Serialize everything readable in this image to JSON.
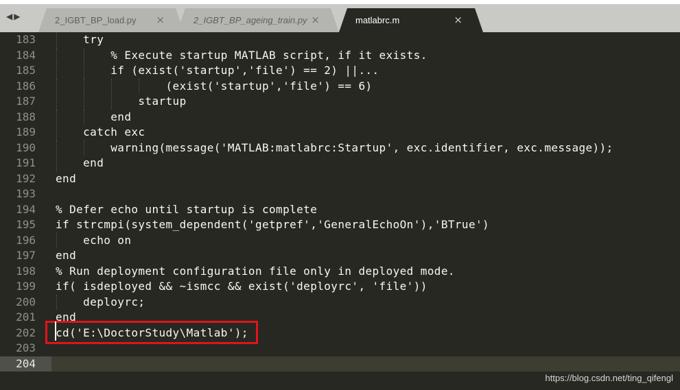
{
  "tabs": [
    {
      "label": "2_IGBT_BP_load.py",
      "close": "×"
    },
    {
      "label": "2_IGBT_BP_ageing_train.py",
      "close": "×"
    },
    {
      "label": "matlabrc.m",
      "close": "×"
    }
  ],
  "nav": {
    "back": "◀",
    "forward": "▶"
  },
  "lines": [
    {
      "n": "183",
      "text": "    try"
    },
    {
      "n": "184",
      "text": "        % Execute startup MATLAB script, if it exists."
    },
    {
      "n": "185",
      "text": "        if (exist('startup','file') == 2) ||..."
    },
    {
      "n": "186",
      "text": "                (exist('startup','file') == 6)"
    },
    {
      "n": "187",
      "text": "            startup"
    },
    {
      "n": "188",
      "text": "        end"
    },
    {
      "n": "189",
      "text": "    catch exc"
    },
    {
      "n": "190",
      "text": "        warning(message('MATLAB:matlabrc:Startup', exc.identifier, exc.message));"
    },
    {
      "n": "191",
      "text": "    end"
    },
    {
      "n": "192",
      "text": "end"
    },
    {
      "n": "193",
      "text": ""
    },
    {
      "n": "194",
      "text": "% Defer echo until startup is complete"
    },
    {
      "n": "195",
      "text": "if strcmpi(system_dependent('getpref','GeneralEchoOn'),'BTrue')"
    },
    {
      "n": "196",
      "text": "    echo on"
    },
    {
      "n": "197",
      "text": "end"
    },
    {
      "n": "198",
      "text": "% Run deployment configuration file only in deployed mode."
    },
    {
      "n": "199",
      "text": "if( isdeployed && ~ismcc && exist('deployrc', 'file'))"
    },
    {
      "n": "200",
      "text": "    deployrc;"
    },
    {
      "n": "201",
      "text": "end"
    },
    {
      "n": "202",
      "text": "cd('E:\\DoctorStudy\\Matlab');"
    },
    {
      "n": "203",
      "text": ""
    },
    {
      "n": "204",
      "text": ""
    }
  ],
  "watermark": "https://blog.csdn.net/ting_qifengl",
  "colors": {
    "background": "#272822",
    "text": "#f8f8f2",
    "gutter": "#90908a",
    "highlight_box": "#e1141b"
  }
}
